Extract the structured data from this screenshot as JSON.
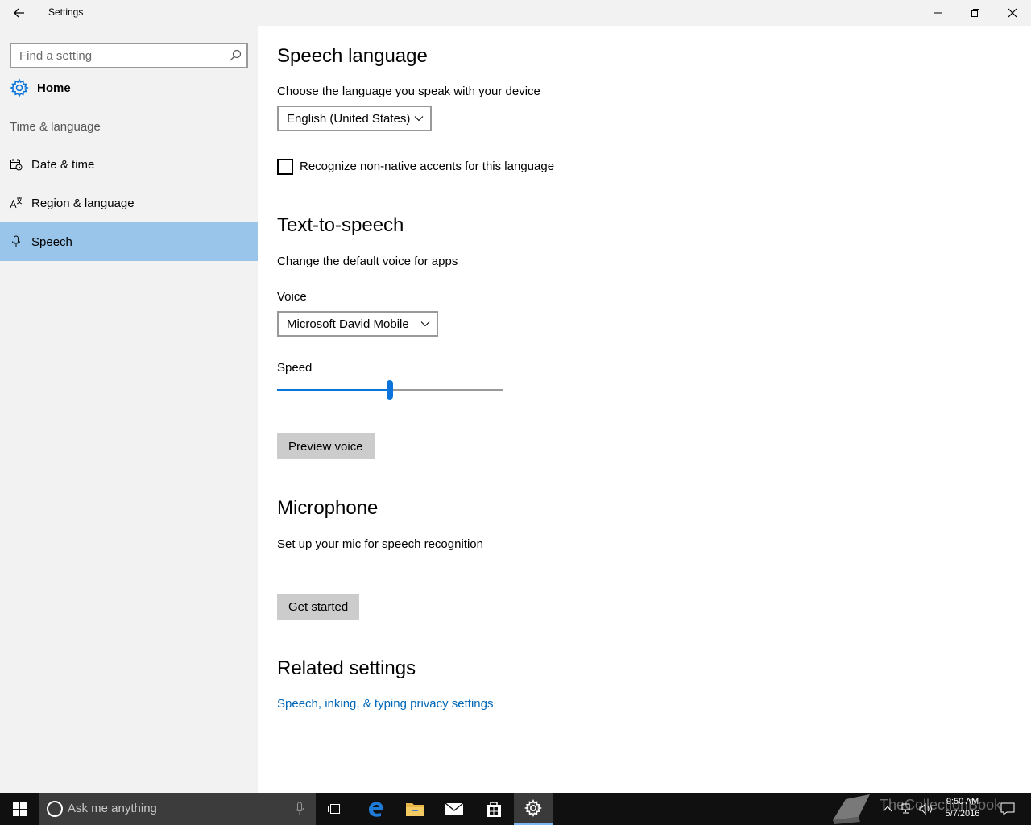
{
  "window": {
    "title": "Settings"
  },
  "sidebar": {
    "search_placeholder": "Find a setting",
    "home_label": "Home",
    "group_label": "Time & language",
    "items": [
      {
        "label": "Date & time",
        "icon": "calendar-clock-icon"
      },
      {
        "label": "Region & language",
        "icon": "language-icon"
      },
      {
        "label": "Speech",
        "icon": "microphone-icon",
        "selected": true
      }
    ]
  },
  "speech_language": {
    "heading": "Speech language",
    "description": "Choose the language you speak with your device",
    "language_value": "English (United States)",
    "accents_checkbox_label": "Recognize non-native accents for this language",
    "accents_checked": false
  },
  "tts": {
    "heading": "Text-to-speech",
    "description": "Change the default voice for apps",
    "voice_label": "Voice",
    "voice_value": "Microsoft David Mobile",
    "speed_label": "Speed",
    "speed_fraction": 0.5,
    "preview_button": "Preview voice"
  },
  "microphone": {
    "heading": "Microphone",
    "description": "Set up your mic for speech recognition",
    "button": "Get started"
  },
  "related": {
    "heading": "Related settings",
    "link": "Speech, inking, & typing privacy settings"
  },
  "taskbar": {
    "search_placeholder": "Ask me anything",
    "time": "9:50 AM",
    "date": "5/7/2016",
    "watermark": "TheCollectionBook"
  },
  "colors": {
    "accent": "#0a74da",
    "selected_nav": "#99c5ea",
    "link": "#0067b8"
  }
}
